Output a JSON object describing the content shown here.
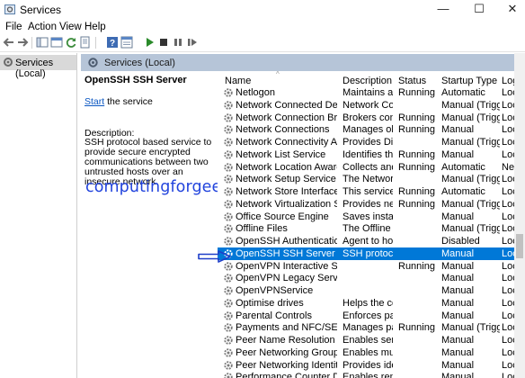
{
  "window": {
    "title": "Services",
    "minimize": "—",
    "maximize": "☐",
    "close": "✕"
  },
  "menu": [
    "File",
    "Action",
    "View",
    "Help"
  ],
  "tree": {
    "root_label": "Services (Local)"
  },
  "main_header": {
    "label": "Services (Local)"
  },
  "details": {
    "service_title": "OpenSSH SSH Server",
    "start_link": "Start",
    "start_suffix": " the service",
    "description_label": "Description:",
    "description_text": "SSH protocol based service to provide secure encrypted communications between two untrusted hosts over an insecure network."
  },
  "watermark": "computingforgeeks.com",
  "columns": {
    "name": "Name",
    "description": "Description",
    "status": "Status",
    "startup": "Startup Type",
    "logon": "Log"
  },
  "rows": [
    {
      "name": "Netlogon",
      "description": "Maintains a ...",
      "status": "Running",
      "startup": "Automatic",
      "logon": "Loc"
    },
    {
      "name": "Network Connected Devices ...",
      "description": "Network Co...",
      "status": "",
      "startup": "Manual (Trigg...",
      "logon": "Loc"
    },
    {
      "name": "Network Connection Broker",
      "description": "Brokers con...",
      "status": "Running",
      "startup": "Manual (Trigg...",
      "logon": "Loc"
    },
    {
      "name": "Network Connections",
      "description": "Manages ob...",
      "status": "Running",
      "startup": "Manual",
      "logon": "Loc"
    },
    {
      "name": "Network Connectivity Assist...",
      "description": "Provides Dir...",
      "status": "",
      "startup": "Manual (Trigg...",
      "logon": "Loc"
    },
    {
      "name": "Network List Service",
      "description": "Identifies th...",
      "status": "Running",
      "startup": "Manual",
      "logon": "Loc"
    },
    {
      "name": "Network Location Awareness",
      "description": "Collects and ...",
      "status": "Running",
      "startup": "Automatic",
      "logon": "Ne"
    },
    {
      "name": "Network Setup Service",
      "description": "The Network...",
      "status": "",
      "startup": "Manual (Trigg...",
      "logon": "Loc"
    },
    {
      "name": "Network Store Interface Ser...",
      "description": "This service ...",
      "status": "Running",
      "startup": "Automatic",
      "logon": "Loc"
    },
    {
      "name": "Network Virtualization Service",
      "description": "Provides net...",
      "status": "Running",
      "startup": "Manual (Trigg...",
      "logon": "Loc"
    },
    {
      "name": "Office  Source Engine",
      "description": "Saves install...",
      "status": "",
      "startup": "Manual",
      "logon": "Loc"
    },
    {
      "name": "Offline Files",
      "description": "The Offline ...",
      "status": "",
      "startup": "Manual (Trigg...",
      "logon": "Loc"
    },
    {
      "name": "OpenSSH Authentication Ag...",
      "description": "Agent to hol...",
      "status": "",
      "startup": "Disabled",
      "logon": "Loc"
    },
    {
      "name": "OpenSSH SSH Server",
      "description": "SSH protoco...",
      "status": "",
      "startup": "Manual",
      "logon": "Loc",
      "selected": true
    },
    {
      "name": "OpenVPN Interactive Service",
      "description": "",
      "status": "Running",
      "startup": "Manual",
      "logon": "Loc"
    },
    {
      "name": "OpenVPN Legacy Service",
      "description": "",
      "status": "",
      "startup": "Manual",
      "logon": "Loc"
    },
    {
      "name": "OpenVPNService",
      "description": "",
      "status": "",
      "startup": "Manual",
      "logon": "Loc"
    },
    {
      "name": "Optimise drives",
      "description": "Helps the co...",
      "status": "",
      "startup": "Manual",
      "logon": "Loc"
    },
    {
      "name": "Parental Controls",
      "description": "Enforces par...",
      "status": "",
      "startup": "Manual",
      "logon": "Loc"
    },
    {
      "name": "Payments and NFC/SE Mana...",
      "description": "Manages pa...",
      "status": "Running",
      "startup": "Manual (Trigg...",
      "logon": "Loc"
    },
    {
      "name": "Peer Name Resolution Proto...",
      "description": "Enables serv...",
      "status": "",
      "startup": "Manual",
      "logon": "Loc"
    },
    {
      "name": "Peer Networking Grouping",
      "description": "Enables mul...",
      "status": "",
      "startup": "Manual",
      "logon": "Loc"
    },
    {
      "name": "Peer Networking Identity M...",
      "description": "Provides ide...",
      "status": "",
      "startup": "Manual",
      "logon": "Loc"
    },
    {
      "name": "Performance Counter DLL H...",
      "description": "Enables rem...",
      "status": "",
      "startup": "Manual",
      "logon": "Loc"
    }
  ],
  "toolbar_icons": [
    "back-icon",
    "forward-icon",
    "show-hide-tree-icon",
    "console-icon",
    "export-icon",
    "help-icon",
    "properties-icon",
    "play-icon",
    "stop-icon",
    "pause-icon",
    "restart-icon"
  ],
  "colors": {
    "selection": "#0078d7",
    "header_band": "#b6c5d8",
    "link": "#0b57c2",
    "watermark": "#2244dd",
    "arrow": "#1f3fc9"
  }
}
